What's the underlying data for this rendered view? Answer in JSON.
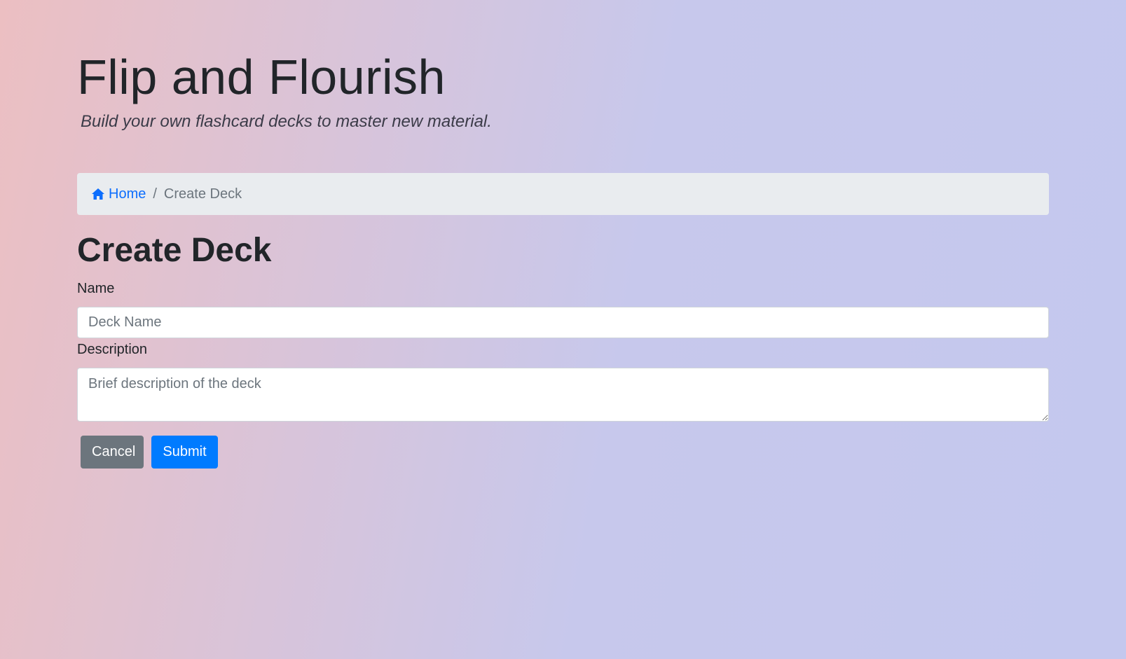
{
  "header": {
    "title": "Flip and Flourish",
    "subtitle": "Build your own flashcard decks to master new material."
  },
  "breadcrumb": {
    "home_label": "Home",
    "home_icon": "home-icon",
    "separator": "/",
    "current": "Create Deck"
  },
  "page": {
    "title": "Create Deck"
  },
  "form": {
    "name_label": "Name",
    "name_value": "",
    "name_placeholder": "Deck Name",
    "description_label": "Description",
    "description_value": "",
    "description_placeholder": "Brief description of the deck",
    "cancel_label": "Cancel",
    "submit_label": "Submit"
  },
  "colors": {
    "link": "#0d6efd",
    "secondary_button": "#6c757d",
    "primary_button": "#007bff",
    "breadcrumb_bg": "#e9ecef"
  }
}
